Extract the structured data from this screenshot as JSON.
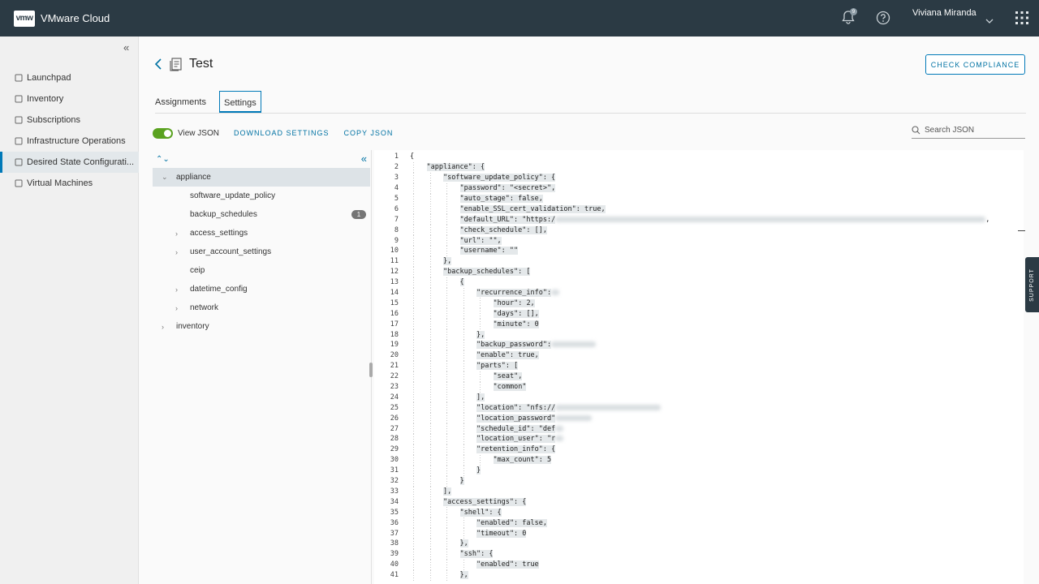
{
  "topbar": {
    "logo": "vmw",
    "brand": "VMware Cloud",
    "notification_count": "9",
    "user_name": "Viviana Miranda"
  },
  "sidebar": {
    "items": [
      {
        "label": "Launchpad",
        "icon": "rocket-icon"
      },
      {
        "label": "Inventory",
        "icon": "inventory-icon"
      },
      {
        "label": "Subscriptions",
        "icon": "subscriptions-icon"
      },
      {
        "label": "Infrastructure Operations",
        "icon": "infrastructure-icon"
      },
      {
        "label": "Desired State Configurati...",
        "icon": "desired-state-icon"
      },
      {
        "label": "Virtual Machines",
        "icon": "vm-icon"
      }
    ],
    "active_index": 4
  },
  "page": {
    "title": "Test",
    "check_compliance": "CHECK COMPLIANCE"
  },
  "tabs": [
    "Assignments",
    "Settings"
  ],
  "toolbar": {
    "view_json": "View JSON",
    "download": "DOWNLOAD SETTINGS",
    "copy": "COPY JSON",
    "search_placeholder": "Search JSON"
  },
  "tree": [
    {
      "label": "appliance",
      "level": 0,
      "expanded": true,
      "selected": true
    },
    {
      "label": "software_update_policy",
      "level": 1
    },
    {
      "label": "backup_schedules",
      "level": 1,
      "badge": "1"
    },
    {
      "label": "access_settings",
      "level": 1,
      "collapsed": true
    },
    {
      "label": "user_account_settings",
      "level": 1,
      "collapsed": true
    },
    {
      "label": "ceip",
      "level": 1
    },
    {
      "label": "datetime_config",
      "level": 1,
      "collapsed": true
    },
    {
      "label": "network",
      "level": 1,
      "collapsed": true
    },
    {
      "label": "inventory",
      "level": 0,
      "collapsed": true
    }
  ],
  "code": [
    {
      "n": "1",
      "i": 0,
      "t": "{"
    },
    {
      "n": "2",
      "i": 1,
      "t": "\"appliance\": {"
    },
    {
      "n": "3",
      "i": 2,
      "t": "\"software_update_policy\": {"
    },
    {
      "n": "4",
      "i": 3,
      "t": "\"password\": \"<secret>\","
    },
    {
      "n": "5",
      "i": 3,
      "t": "\"auto_stage\": false,"
    },
    {
      "n": "6",
      "i": 3,
      "t": "\"enable_SSL_cert_validation\": true,"
    },
    {
      "n": "7",
      "i": 3,
      "t": "\"default_URL\": \"https:/",
      "blur": 530,
      "tail": ","
    },
    {
      "n": "8",
      "i": 3,
      "t": "\"check_schedule\": [],"
    },
    {
      "n": "9",
      "i": 3,
      "t": "\"url\": \"\","
    },
    {
      "n": "10",
      "i": 3,
      "t": "\"username\": \"\""
    },
    {
      "n": "11",
      "i": 2,
      "t": "},"
    },
    {
      "n": "12",
      "i": 2,
      "t": "\"backup_schedules\": ["
    },
    {
      "n": "13",
      "i": 3,
      "t": "{"
    },
    {
      "n": "14",
      "i": 4,
      "t": "\"recurrence_info\":",
      "blur": 10
    },
    {
      "n": "15",
      "i": 5,
      "t": "\"hour\": 2,"
    },
    {
      "n": "16",
      "i": 5,
      "t": "\"days\": [],"
    },
    {
      "n": "17",
      "i": 5,
      "t": "\"minute\": 0"
    },
    {
      "n": "18",
      "i": 4,
      "t": "},"
    },
    {
      "n": "19",
      "i": 4,
      "t": "\"backup_password\":",
      "blur": 55
    },
    {
      "n": "20",
      "i": 4,
      "t": "\"enable\": true,"
    },
    {
      "n": "21",
      "i": 4,
      "t": "\"parts\": ["
    },
    {
      "n": "22",
      "i": 5,
      "t": "\"seat\","
    },
    {
      "n": "23",
      "i": 5,
      "t": "\"common\""
    },
    {
      "n": "24",
      "i": 4,
      "t": "],"
    },
    {
      "n": "25",
      "i": 4,
      "t": "\"location\": \"nfs://",
      "blur": 130
    },
    {
      "n": "26",
      "i": 4,
      "t": "\"location_password\"",
      "blur": 45
    },
    {
      "n": "27",
      "i": 4,
      "t": "\"schedule_id\": \"def",
      "blur": 10
    },
    {
      "n": "28",
      "i": 4,
      "t": "\"location_user\": \"r",
      "blur": 10
    },
    {
      "n": "29",
      "i": 4,
      "t": "\"retention_info\": {"
    },
    {
      "n": "30",
      "i": 5,
      "t": "\"max_count\": 5"
    },
    {
      "n": "31",
      "i": 4,
      "t": "}"
    },
    {
      "n": "32",
      "i": 3,
      "t": "}"
    },
    {
      "n": "33",
      "i": 2,
      "t": "],"
    },
    {
      "n": "34",
      "i": 2,
      "t": "\"access_settings\": {"
    },
    {
      "n": "35",
      "i": 3,
      "t": "\"shell\": {"
    },
    {
      "n": "36",
      "i": 4,
      "t": "\"enabled\": false,"
    },
    {
      "n": "37",
      "i": 4,
      "t": "\"timeout\": 0"
    },
    {
      "n": "38",
      "i": 3,
      "t": "},"
    },
    {
      "n": "39",
      "i": 3,
      "t": "\"ssh\": {"
    },
    {
      "n": "40",
      "i": 4,
      "t": "\"enabled\": true"
    },
    {
      "n": "41",
      "i": 3,
      "t": "},"
    }
  ],
  "support_label": "SUPPORT"
}
